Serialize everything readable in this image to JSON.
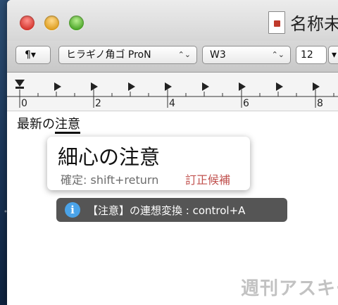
{
  "window": {
    "title": "名称未"
  },
  "toolbar": {
    "paragraph_symbol": "¶",
    "paragraph_arrow": "▾",
    "font": "ヒラギノ角ゴ ProN",
    "weight": "W3",
    "size": "12",
    "popup_arrows": "⌃⌄"
  },
  "ruler": {
    "labels": [
      "0",
      "2",
      "4",
      "6",
      "8"
    ]
  },
  "document": {
    "prefix": "最新の",
    "converting": "注意"
  },
  "candidate": {
    "main": "細心の注意",
    "confirm": "確定: shift+return",
    "correction": "訂正候補"
  },
  "hint": {
    "icon": "info-icon",
    "glyph": "i",
    "text": "【注意】の連想変換 : control+A"
  },
  "watermark": "週刊アスキー",
  "colors": {
    "accent_blue": "#4aa3e8",
    "correction_red": "#c0504d"
  }
}
